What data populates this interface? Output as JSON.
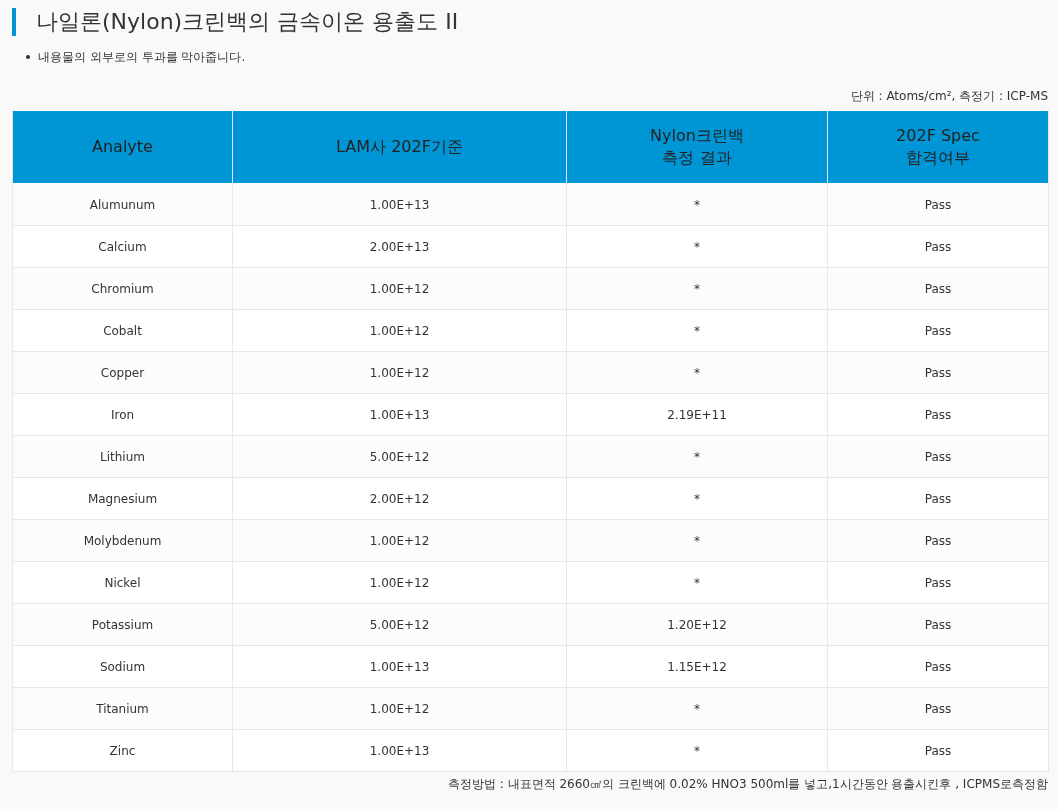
{
  "title": "나일론(Nylon)크린백의 금속이온 용출도 II",
  "bullets": [
    "내용물의 외부로의 투과를 막아줍니다."
  ],
  "unit_note": "단위 : Atoms/cm², 측정기 : ICP-MS",
  "table": {
    "columns": [
      "Analyte",
      "LAM사 202F기준",
      "Nylon크린백\n측정 결과",
      "202F Spec\n합격여부"
    ],
    "rows": [
      [
        "Alumunum",
        "1.00E+13",
        "*",
        "Pass"
      ],
      [
        "Calcium",
        "2.00E+13",
        "*",
        "Pass"
      ],
      [
        "Chromium",
        "1.00E+12",
        "*",
        "Pass"
      ],
      [
        "Cobalt",
        "1.00E+12",
        "*",
        "Pass"
      ],
      [
        "Copper",
        "1.00E+12",
        "*",
        "Pass"
      ],
      [
        "Iron",
        "1.00E+13",
        "2.19E+11",
        "Pass"
      ],
      [
        "Lithium",
        "5.00E+12",
        "*",
        "Pass"
      ],
      [
        "Magnesium",
        "2.00E+12",
        "*",
        "Pass"
      ],
      [
        "Molybdenum",
        "1.00E+12",
        "*",
        "Pass"
      ],
      [
        "Nickel",
        "1.00E+12",
        "*",
        "Pass"
      ],
      [
        "Potassium",
        "5.00E+12",
        "1.20E+12",
        "Pass"
      ],
      [
        "Sodium",
        "1.00E+13",
        "1.15E+12",
        "Pass"
      ],
      [
        "Titanium",
        "1.00E+12",
        "*",
        "Pass"
      ],
      [
        "Zinc",
        "1.00E+13",
        "*",
        "Pass"
      ]
    ]
  },
  "footnote": "측정방법 : 내표면적 2660㎠의 크린백에 0.02% HNO3 500ml를 넣고,1시간동안 용출시킨후 , ICPMS로측정함"
}
